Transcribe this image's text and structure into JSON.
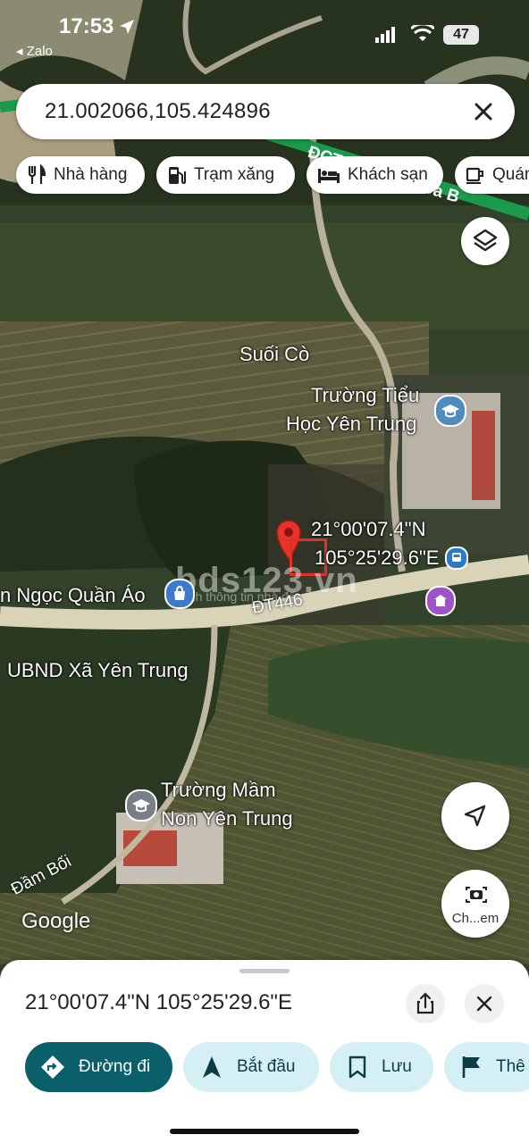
{
  "status_bar": {
    "time": "17:53",
    "back_app": "◂ Zalo",
    "battery": "47"
  },
  "search": {
    "value": "21.002066,105.424896"
  },
  "chips": [
    {
      "label": "Nhà hàng",
      "icon": "fork-knife-icon"
    },
    {
      "label": "Trạm xăng",
      "icon": "gas-pump-icon"
    },
    {
      "label": "Khách sạn",
      "icon": "bed-icon"
    },
    {
      "label": "Quán",
      "icon": "coffee-cup-icon"
    }
  ],
  "map": {
    "labels": {
      "suoi_co": "Suối Cò",
      "school_1_line1": "Trường Tiểu",
      "school_1_line2": "Học Yên Trung",
      "pin_lat": "21°00'07.4\"N",
      "pin_lng": "105°25'29.6\"E",
      "shop": "n Ngọc Quần Áo",
      "road_dt": "ĐT446",
      "ubnd": "UBND Xã Yên Trung",
      "school_2_line1": "Trường Mầm",
      "school_2_line2": "Non Yên Trung",
      "dam_boi": "Đầm Bối",
      "google": "Google",
      "road_top": "ĐCT Hà Nội - Hòa B",
      "watermark": "bds123.vn",
      "watermark_sub": "kênh thông tin nhà đất"
    },
    "camera_label": "Ch...em"
  },
  "sheet": {
    "coordinates": "21°00'07.4\"N 105°25'29.6\"E",
    "actions": [
      {
        "label": "Đường đi",
        "icon": "directions-icon",
        "primary": true
      },
      {
        "label": "Bắt đầu",
        "icon": "navigation-arrow-icon",
        "primary": false
      },
      {
        "label": "Lưu",
        "icon": "bookmark-icon",
        "primary": false
      },
      {
        "label": "Thê",
        "icon": "flag-icon",
        "primary": false
      }
    ]
  },
  "colors": {
    "primary_button": "#0b5f6b",
    "secondary_button": "#d5f0f4",
    "pin_red": "#e8332a"
  }
}
